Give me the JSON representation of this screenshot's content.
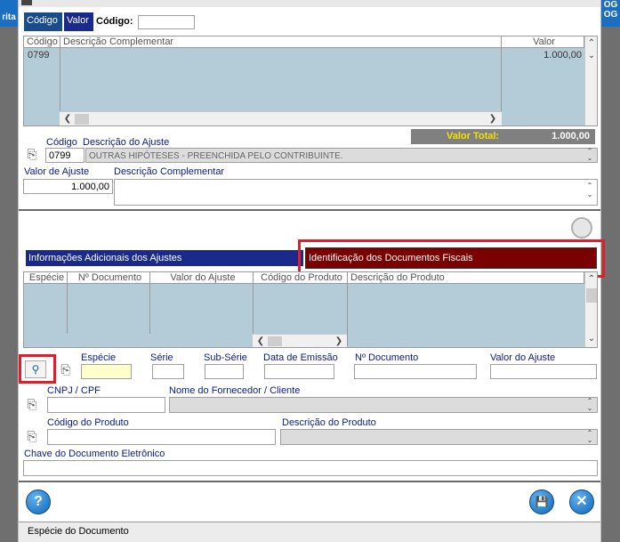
{
  "background": {
    "left_tab": "rita",
    "right_tab_1": "OG",
    "right_tab_2": "OG"
  },
  "top_tabs": {
    "codigo_tab": "Código",
    "valor_tab": "Valor",
    "search_label": "Código:",
    "search_value": ""
  },
  "top_grid": {
    "columns": [
      "Código",
      "Descrição Complementar",
      "Valor"
    ],
    "rows": [
      {
        "codigo": "0799",
        "descricao": "",
        "valor": "1.000,00"
      }
    ]
  },
  "valor_total": {
    "label": "Valor Total:",
    "value": "1.000,00"
  },
  "ajuste": {
    "codigo_label": "Código",
    "descricao_label": "Descrição do Ajuste",
    "codigo_value": "0799",
    "descricao_value": "OUTRAS HIPÓTESES - PREENCHIDA PELO CONTRIBUINTE.",
    "valor_label": "Valor de Ajuste",
    "valor_value": "1.000,00",
    "desc_comp_label": "Descrição Complementar",
    "desc_comp_value": ""
  },
  "section_tabs": {
    "info_tab": "Informações Adicionais dos Ajustes",
    "docs_tab": "Identificação dos Documentos Fiscais"
  },
  "docs_grid": {
    "columns": [
      "Espécie",
      "Nº Documento",
      "Valor do Ajuste",
      "Código do Produto",
      "Descrição do Produto"
    ]
  },
  "doc_form": {
    "especie_label": "Espécie",
    "serie_label": "Série",
    "subserie_label": "Sub-Série",
    "data_label": "Data de Emissão",
    "ndoc_label": "Nº Documento",
    "valor_label": "Valor do Ajuste",
    "cnpj_label": "CNPJ / CPF",
    "nome_label": "Nome do Fornecedor / Cliente",
    "cod_prod_label": "Código do Produto",
    "desc_prod_label": "Descrição do Produto",
    "chave_label": "Chave do Documento Eletrônico"
  },
  "status_bar": {
    "text": "Espécie do Documento"
  },
  "colors": {
    "selected_tab": "#1a2a8a",
    "docs_tab": "#7b0000",
    "highlight": "#e01e2b",
    "grid_bg": "#b4cbd8",
    "total_bg": "#808080",
    "total_text": "#f5e000"
  }
}
